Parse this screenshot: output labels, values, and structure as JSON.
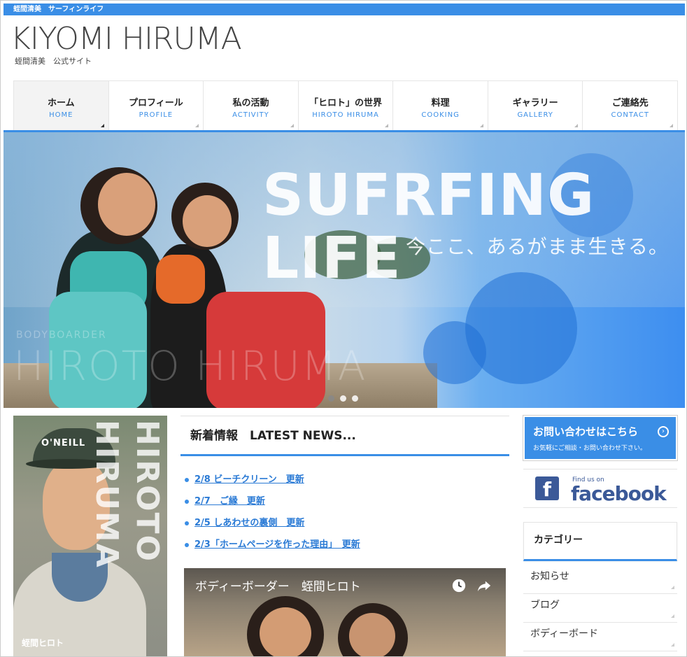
{
  "header": {
    "topbar": "蛭間清美　サーフィンライフ",
    "logo": "KIYOMI HIRUMA",
    "logo_sub": "蛭間清美　公式サイト"
  },
  "nav": [
    {
      "jp": "ホーム",
      "en": "HOME"
    },
    {
      "jp": "プロフィール",
      "en": "PROFILE"
    },
    {
      "jp": "私の活動",
      "en": "ACTIVITY"
    },
    {
      "jp": "「ヒロト」の世界",
      "en": "HIROTO HIRUMA"
    },
    {
      "jp": "料理",
      "en": "COOKING"
    },
    {
      "jp": "ギャラリー",
      "en": "GALLERY"
    },
    {
      "jp": "ご連絡先",
      "en": "CONTACT"
    }
  ],
  "hero": {
    "title": "SUFRFING LIFE",
    "subtitle": "今ここ、あるがまま生きる。",
    "watermark": "HIROTO HIRUMA",
    "watermark_small": "BODYBOARDER",
    "slides_total": 3,
    "active_slide": 1
  },
  "portrait": {
    "vertical_text": "HIROTO HIRUMA",
    "cap_text": "O'NEILL",
    "name": "蛭間ヒロト"
  },
  "news": {
    "heading": "新着情報　LATEST NEWS...",
    "items": [
      "2/8 ビーチクリーン　更新",
      "2/7　ご縁　更新",
      " 2/5 しあわせの裏側　更新",
      "2/3「ホームページを作った理由」　更新"
    ]
  },
  "video": {
    "title": "ボディーボーダー　蛭間ヒロト"
  },
  "sidebar": {
    "contact_main": "お問い合わせはこちら",
    "contact_sub": "お気軽にご相談・お問い合わせ下さい。",
    "fb_find": "Find us on",
    "fb_word": "facebook",
    "category_heading": "カテゴリー",
    "categories": [
      "お知らせ",
      "ブログ",
      "ボディーボード"
    ]
  },
  "colors": {
    "accent": "#3a8ee6",
    "facebook": "#3b5998"
  }
}
